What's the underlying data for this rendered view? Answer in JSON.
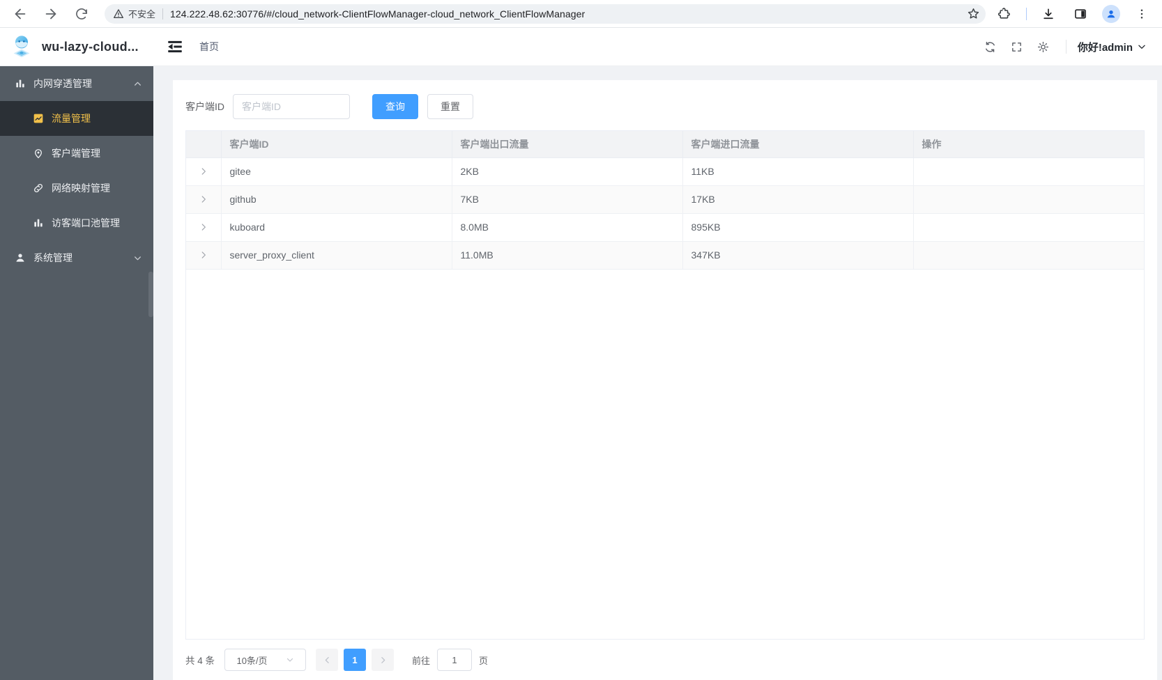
{
  "browser": {
    "security_label": "不安全",
    "url": "124.222.48.62:30776/#/cloud_network-ClientFlowManager-cloud_network_ClientFlowManager",
    "icons": [
      "back-icon",
      "forward-icon",
      "reload-icon",
      "warning-icon",
      "star-icon",
      "extensions-icon",
      "download-icon",
      "side-panel-icon",
      "profile-avatar-icon",
      "kebab-menu-icon"
    ]
  },
  "header": {
    "app_title": "wu-lazy-cloud...",
    "breadcrumb": "首页",
    "greeting": "你好!admin",
    "icons": [
      "collapse-sidebar-icon",
      "refresh-icon",
      "fullscreen-icon",
      "theme-icon",
      "chevron-down-icon"
    ]
  },
  "sidebar": {
    "groups": [
      {
        "label": "内网穿透管理",
        "expanded": true,
        "icon": "bar-chart-icon",
        "children": [
          {
            "label": "流量管理",
            "icon": "trend-chart-icon",
            "active": true
          },
          {
            "label": "客户端管理",
            "icon": "map-pin-icon",
            "active": false
          },
          {
            "label": "网络映射管理",
            "icon": "link-icon",
            "active": false
          },
          {
            "label": "访客端口池管理",
            "icon": "bar-chart-icon",
            "active": false
          }
        ]
      },
      {
        "label": "系统管理",
        "expanded": false,
        "icon": "user-icon",
        "children": []
      }
    ]
  },
  "filter": {
    "label": "客户端ID",
    "placeholder": "客户端ID",
    "query_label": "查询",
    "reset_label": "重置"
  },
  "table": {
    "columns": [
      "客户端ID",
      "客户端出口流量",
      "客户端进口流量",
      "操作"
    ],
    "rows": [
      {
        "client_id": "gitee",
        "outbound": "2KB",
        "inbound": "11KB"
      },
      {
        "client_id": "github",
        "outbound": "7KB",
        "inbound": "17KB"
      },
      {
        "client_id": "kuboard",
        "outbound": "8.0MB",
        "inbound": "895KB"
      },
      {
        "client_id": "server_proxy_client",
        "outbound": "11.0MB",
        "inbound": "347KB"
      }
    ]
  },
  "pagination": {
    "total_label": "共 4 条",
    "page_size_label": "10条/页",
    "current_page": "1",
    "goto_label": "前往",
    "goto_value": "1",
    "page_unit_label": "页"
  },
  "colors": {
    "accent": "#409eff",
    "sidebar_bg": "#545c64",
    "sidebar_active_bg": "#2b3036",
    "sidebar_active_text": "#f1c04a",
    "table_header_bg": "#f2f3f5",
    "striped_row_bg": "#fafafa"
  }
}
